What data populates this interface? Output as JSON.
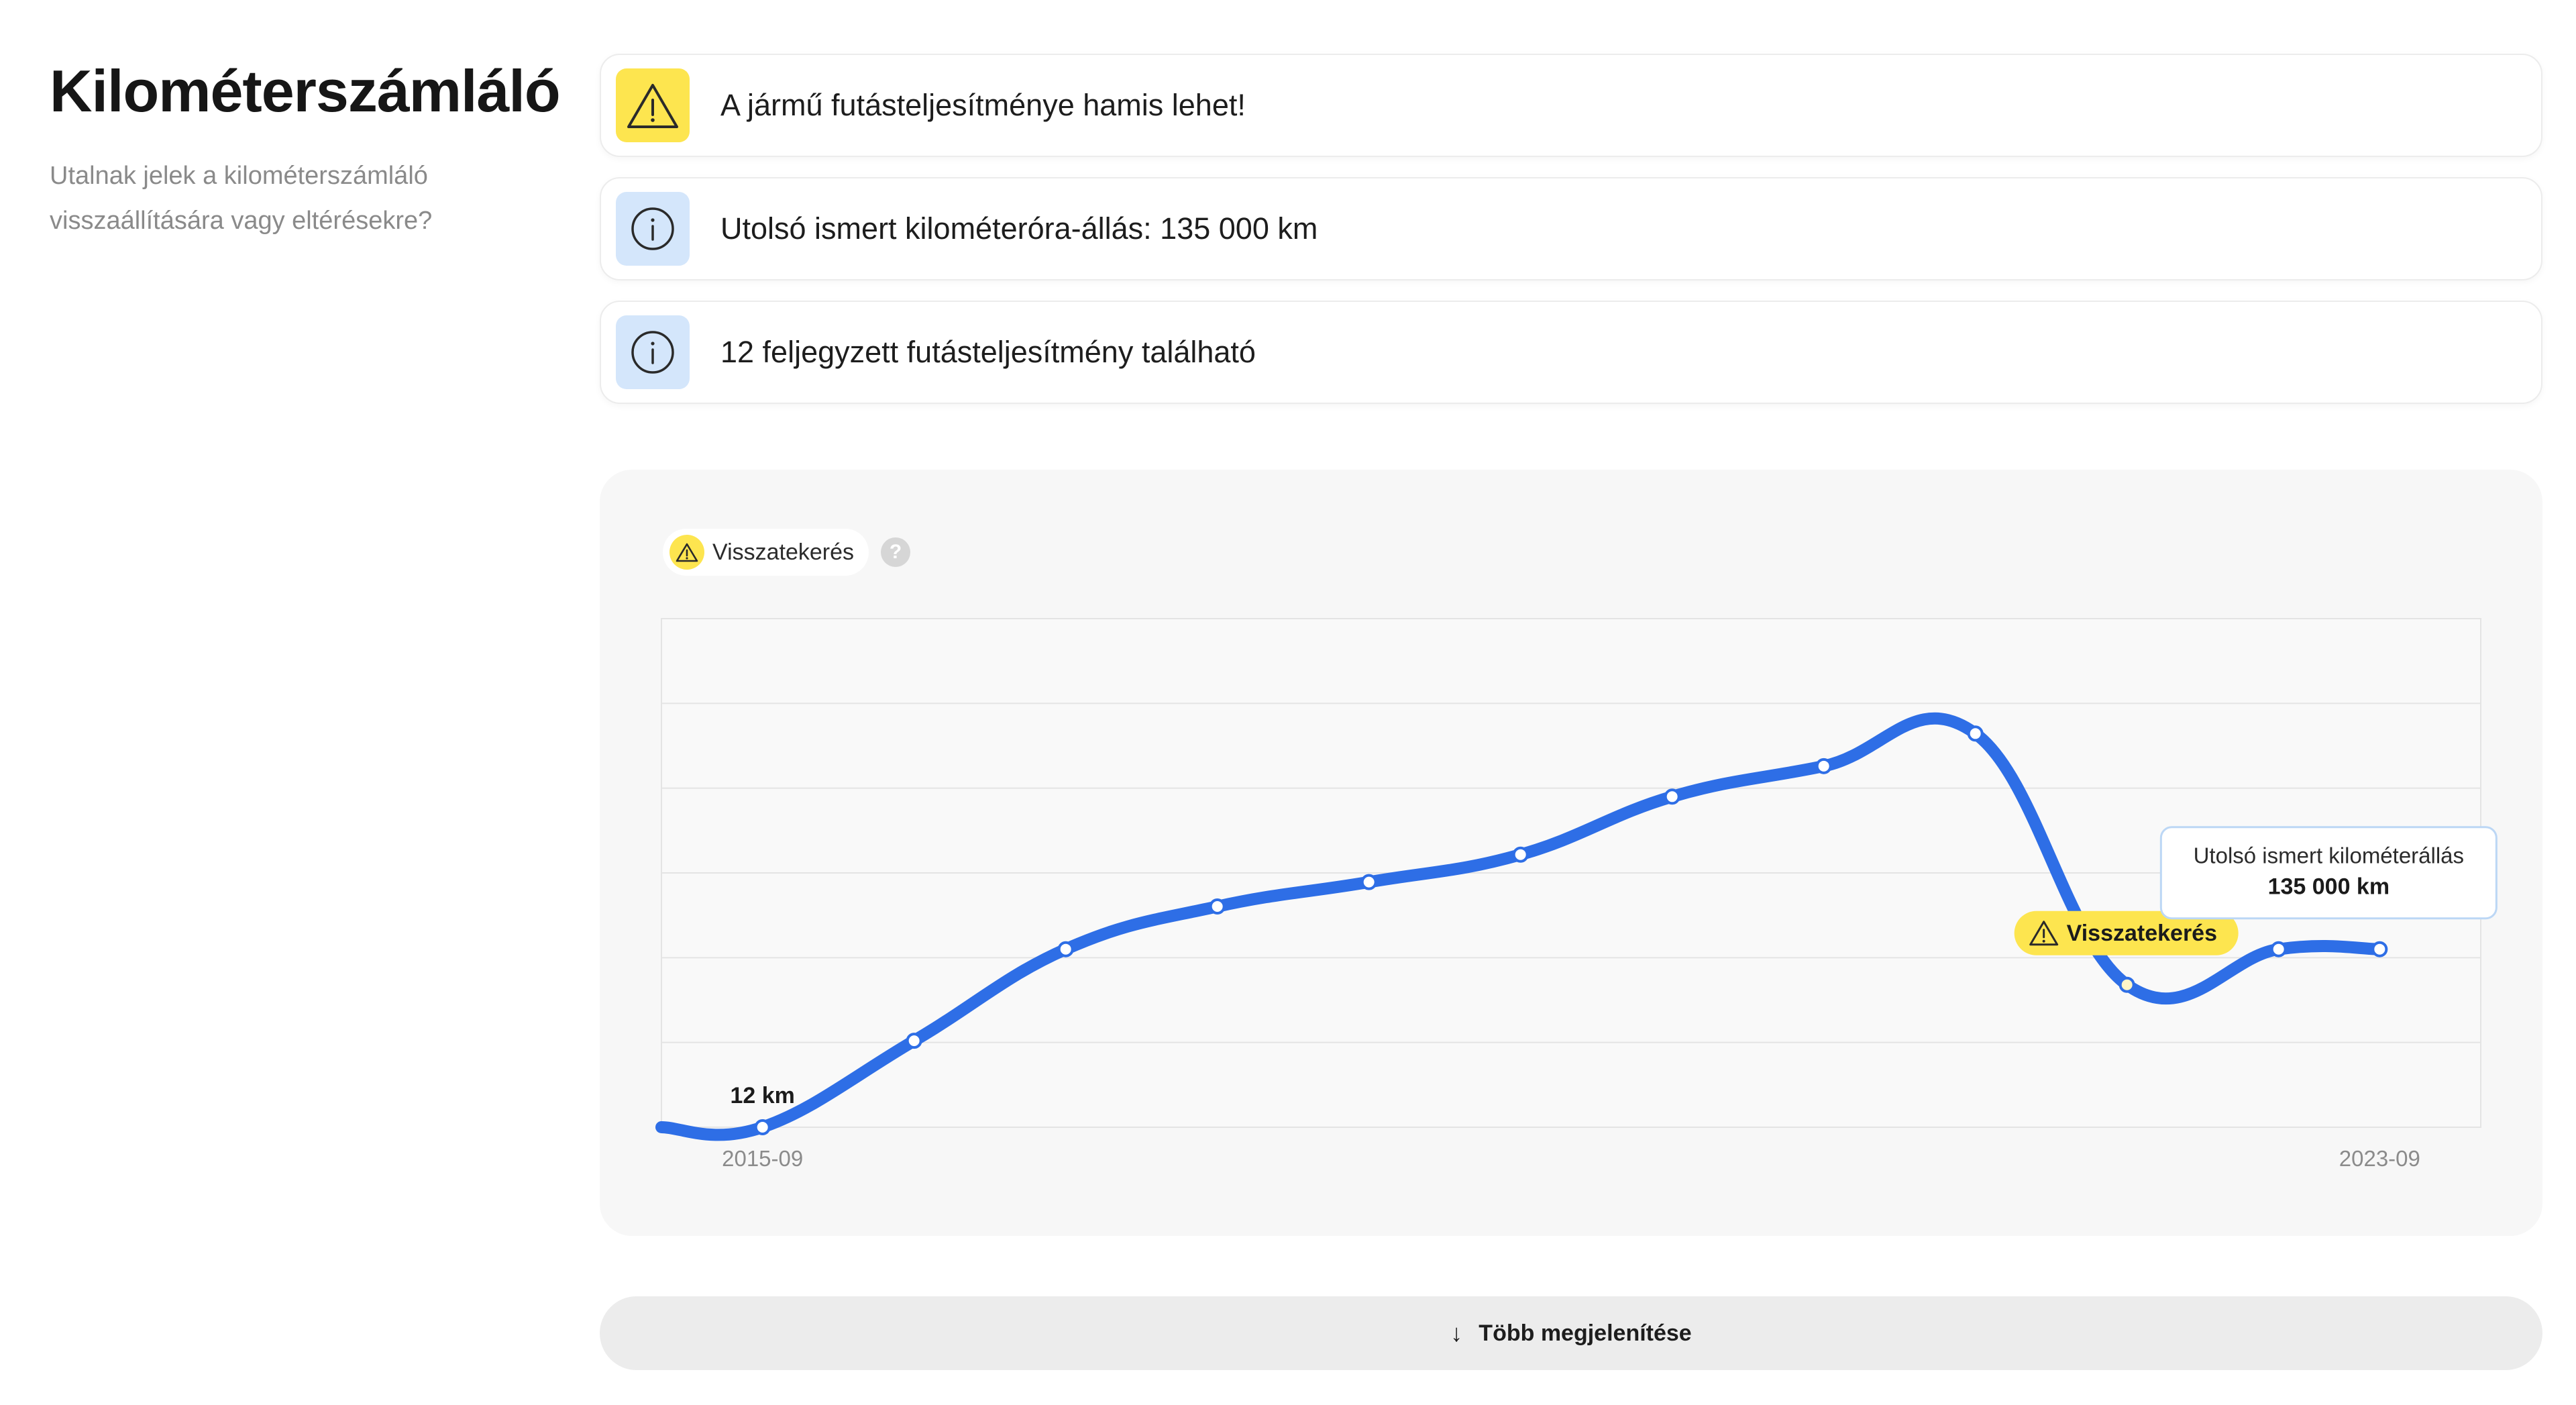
{
  "header": {
    "title": "Kilométerszámláló",
    "subtitle": "Utalnak jelek a kilométerszámláló visszaállítására vagy eltérésekre?"
  },
  "alerts": [
    {
      "type": "warning",
      "icon": "warning-triangle-icon",
      "text": "A jármű futásteljesítménye hamis lehet!",
      "color": "#fde54f"
    },
    {
      "type": "info",
      "icon": "info-circle-icon",
      "text": "Utolsó ismert kilométeróra-állás: 135 000 km",
      "color": "#d4e6fb"
    },
    {
      "type": "info",
      "icon": "info-circle-icon",
      "text": "12 feljegyzett futásteljesítmény található",
      "color": "#d4e6fb"
    }
  ],
  "legend": {
    "label": "Visszatekerés",
    "help": "?"
  },
  "colors": {
    "line": "#2e6ee6",
    "warning": "#fde54f",
    "tooltip_border": "#bcd7f5",
    "grid": "#e4e4e4"
  },
  "chart_data": {
    "type": "line",
    "x": [
      "2015-09",
      "2016-06",
      "2017-03",
      "2017-12",
      "2018-09",
      "2019-06",
      "2020-03",
      "2020-12",
      "2021-09",
      "2022-06",
      "2023-03",
      "2023-09"
    ],
    "values": [
      12,
      85000,
      175000,
      217000,
      241000,
      268000,
      325000,
      355000,
      387000,
      140000,
      175000,
      175000
    ],
    "xlim": [
      "2015-03",
      "2024-03"
    ],
    "ylim": [
      0,
      500000
    ],
    "tick_labels": [
      "2015-09",
      "2023-09"
    ],
    "grid": true,
    "annotations": {
      "first_label": "12 km",
      "rollback_label": "Visszatekerés",
      "last_title": "Utolsó ismert kilométerállás",
      "last_value": "135 000 km"
    }
  },
  "more_button": {
    "label": "Több megjelenítése",
    "arrow": "↓"
  }
}
